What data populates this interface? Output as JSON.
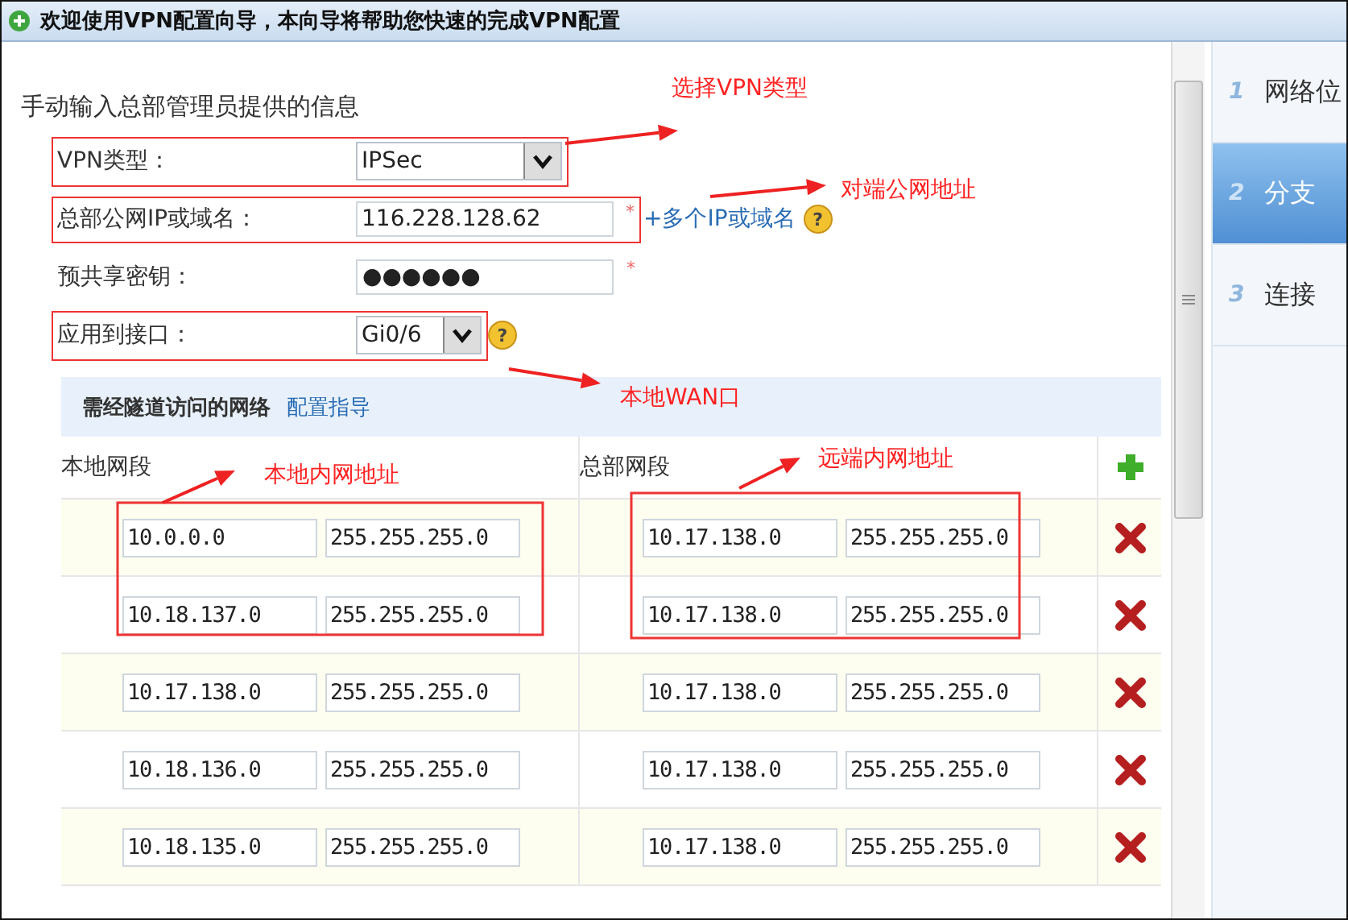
{
  "window": {
    "title": "欢迎使用VPN配置向导，本向导将帮助您快速的完成VPN配置"
  },
  "form": {
    "heading": "手动输入总部管理员提供的信息",
    "fields": [
      {
        "kind": "select",
        "label": "VPN类型：",
        "value": "IPSec"
      },
      {
        "kind": "text",
        "label": "总部公网IP或域名：",
        "value": "116.228.128.62",
        "required_mark": "*",
        "link": "+多个IP或域名",
        "help_icon": "?"
      },
      {
        "kind": "text",
        "label": "预共享密钥：",
        "value": "●●●●●●",
        "required_mark": "*"
      },
      {
        "kind": "select",
        "label": "应用到接口：",
        "value": "Gi0/6",
        "help_icon": "?"
      }
    ]
  },
  "networks": {
    "title": "需经隧道访问的网络",
    "link": "配置指导",
    "columns": [
      "本地网段",
      "总部网段"
    ],
    "rows": [
      {
        "local_network": "10.0.0.0",
        "local_mask": "255.255.255.0",
        "remote_network": "10.17.138.0",
        "remote_mask": "255.255.255.0"
      },
      {
        "local_network": "10.18.137.0",
        "local_mask": "255.255.255.0",
        "remote_network": "10.17.138.0",
        "remote_mask": "255.255.255.0"
      },
      {
        "local_network": "10.17.138.0",
        "local_mask": "255.255.255.0",
        "remote_network": "10.17.138.0",
        "remote_mask": "255.255.255.0"
      },
      {
        "local_network": "10.18.136.0",
        "local_mask": "255.255.255.0",
        "remote_network": "10.17.138.0",
        "remote_mask": "255.255.255.0"
      },
      {
        "local_network": "10.18.135.0",
        "local_mask": "255.255.255.0",
        "remote_network": "10.17.138.0",
        "remote_mask": "255.255.255.0"
      }
    ]
  },
  "steps": [
    {
      "number": "1",
      "label": "网络位",
      "selected": false
    },
    {
      "number": "2",
      "label": "分支",
      "selected": true
    },
    {
      "number": "3",
      "label": "连接",
      "selected": false
    }
  ],
  "annotations": [
    {
      "text": "选择VPN类型"
    },
    {
      "text": "对端公网地址"
    },
    {
      "text": "本地WAN口"
    },
    {
      "text": "本地内网地址"
    },
    {
      "text": "远端内网地址"
    }
  ]
}
